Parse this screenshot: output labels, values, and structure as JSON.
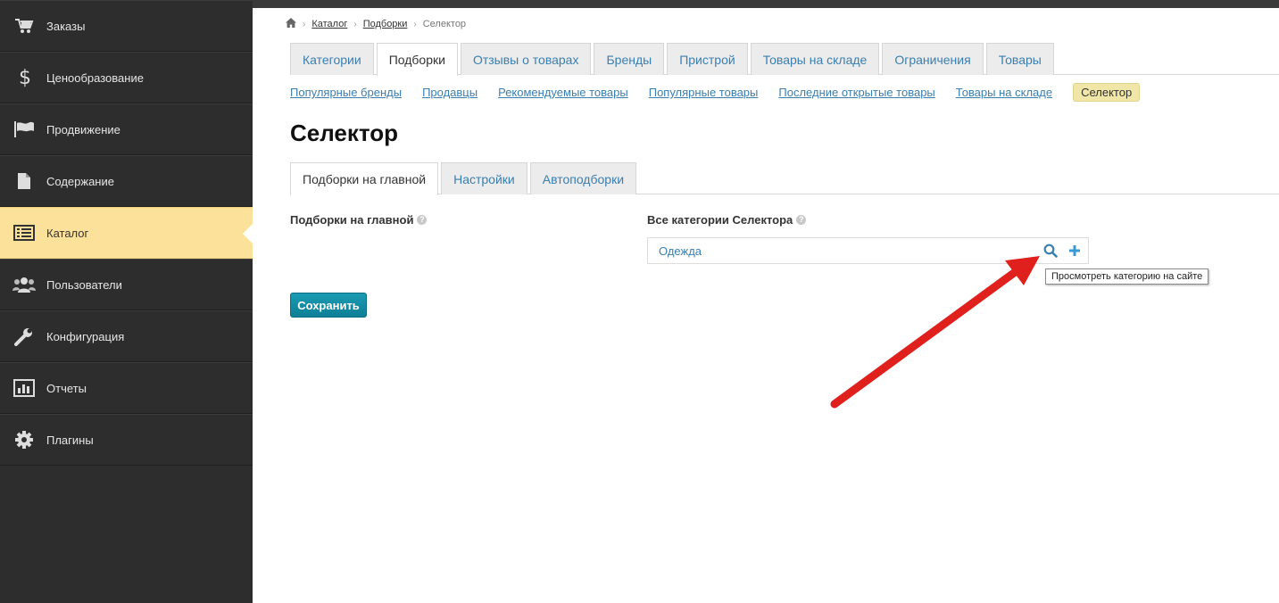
{
  "sidebar": {
    "items": [
      {
        "label": "Заказы",
        "icon": "cart-icon"
      },
      {
        "label": "Ценообразование",
        "icon": "dollar-icon"
      },
      {
        "label": "Продвижение",
        "icon": "flag-icon"
      },
      {
        "label": "Содержание",
        "icon": "file-icon"
      },
      {
        "label": "Каталог",
        "icon": "catalog-list-icon"
      },
      {
        "label": "Пользователи",
        "icon": "users-icon"
      },
      {
        "label": "Конфигурация",
        "icon": "wrench-icon"
      },
      {
        "label": "Отчеты",
        "icon": "chart-icon"
      },
      {
        "label": "Плагины",
        "icon": "gear-icon"
      }
    ]
  },
  "breadcrumb": {
    "home_icon": "home-icon",
    "items": [
      "Каталог",
      "Подборки",
      "Селектор"
    ]
  },
  "tabs": [
    "Категории",
    "Подборки",
    "Отзывы о товарах",
    "Бренды",
    "Пристрой",
    "Товары на складе",
    "Ограничения",
    "Товары"
  ],
  "subnav": [
    "Популярные бренды",
    "Продавцы",
    "Рекомендуемые товары",
    "Популярные товары",
    "Последние открытые товары",
    "Товары на складе",
    "Селектор"
  ],
  "page_title": "Селектор",
  "inner_tabs": [
    "Подборки на главной",
    "Настройки",
    "Автоподборки"
  ],
  "form": {
    "left_label": "Подборки на главной",
    "right_label": "Все категории Селектора",
    "category_value": "Одежда",
    "tooltip": "Просмотреть категорию на сайте",
    "save_label": "Сохранить"
  },
  "colors": {
    "sidebar_bg": "#2d2d2d",
    "active_item": "#fbe19a",
    "link": "#3a7fb0",
    "save_button": "#1a9bb3",
    "arrow": "#e0201c"
  }
}
